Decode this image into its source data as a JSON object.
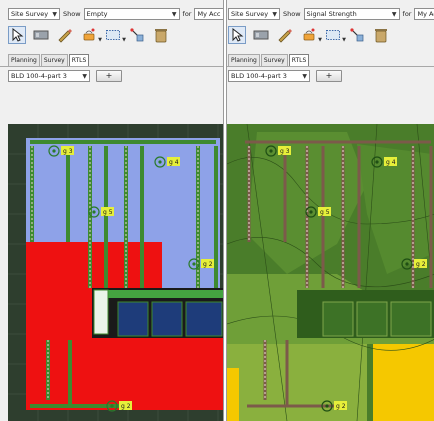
{
  "panels": [
    {
      "id": "left",
      "mode_select": "Site Survey",
      "show_label": "Show",
      "show_select": "Empty",
      "for_label": "for",
      "for_value": "My Acc",
      "tabs": [
        {
          "label": "Planning",
          "active": false
        },
        {
          "label": "Survey",
          "active": false
        },
        {
          "label": "RTLS",
          "active": true
        }
      ],
      "floor_select": "BLD 100-4-part 3",
      "add_button": "+",
      "access_points": [
        {
          "label": "g 3"
        },
        {
          "label": "g 4"
        },
        {
          "label": "g 5"
        },
        {
          "label": "g 2"
        },
        {
          "label": "g 2"
        }
      ]
    },
    {
      "id": "right",
      "mode_select": "Site Survey",
      "show_label": "Show",
      "show_select": "Signal Strength",
      "for_label": "for",
      "for_value": "My Ac",
      "tabs": [
        {
          "label": "Planning",
          "active": false
        },
        {
          "label": "Survey",
          "active": false
        },
        {
          "label": "RTLS",
          "active": true
        }
      ],
      "floor_select": "BLD 100-4-part 3",
      "add_button": "+",
      "access_points": [
        {
          "label": "g 3"
        },
        {
          "label": "g 4"
        },
        {
          "label": "g 5"
        },
        {
          "label": "g 2"
        },
        {
          "label": "g 2"
        }
      ]
    }
  ],
  "toolbar_icons": [
    "select-pointer-icon",
    "rectangle-icon",
    "pencil-icon",
    "access-point-icon",
    "dotted-rectangle-icon",
    "measure-icon",
    "trash-icon"
  ],
  "colors": {
    "blue_zone": "#8ea2e8",
    "red_zone": "#ee1111",
    "wall_green": "#3e8a2f",
    "heatmap_dark": "#3f6f24",
    "heatmap_light": "#7fae3c",
    "heatmap_yellow": "#f5c800"
  }
}
